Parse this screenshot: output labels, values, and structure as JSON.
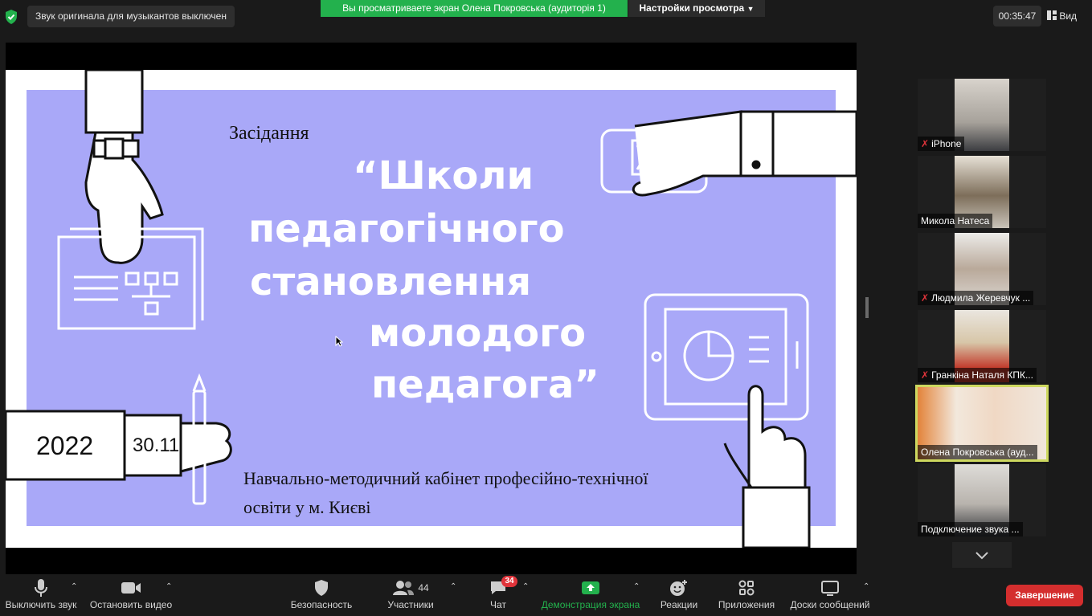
{
  "topbar": {
    "audio_notice": "Звук оригинала для музыкантов выключен",
    "share_banner": "Вы просматриваете экран Олена Покровська (аудиторія 1)",
    "view_settings": "Настройки просмотра",
    "timer": "00:35:47",
    "view_label": "Вид"
  },
  "slide": {
    "heading_small": "Засідання",
    "title_line1": "“Школи",
    "title_line2": "педагогічного",
    "title_line3": "становлення",
    "title_line4": "молодого",
    "title_line5": "педагога”",
    "year": "2022",
    "date": "30.11",
    "org_line1": "Навчально-методичний кабінет професійно-технічної",
    "org_line2": "освіти у м. Києві"
  },
  "participants": [
    {
      "name": "iPhone",
      "muted": true
    },
    {
      "name": "Микола Натеса",
      "muted": false
    },
    {
      "name": "Людмила Жеревчук ...",
      "muted": true
    },
    {
      "name": "Гранкіна Наталя КПК...",
      "muted": true
    },
    {
      "name": "Олена Покровська (ауд...",
      "muted": false
    },
    {
      "name": "Подключение звука ...",
      "muted": false
    }
  ],
  "toolbar": {
    "mute": "Выключить звук",
    "video": "Остановить видео",
    "security": "Безопасность",
    "participants": "Участники",
    "participants_count": "44",
    "chat": "Чат",
    "chat_badge": "34",
    "share": "Демонстрация экрана",
    "reactions": "Реакции",
    "apps": "Приложения",
    "boards": "Доски сообщений",
    "end": "Завершение"
  },
  "colors": {
    "share_green": "#23b14d",
    "slide_purple": "#a9a8f8",
    "end_red": "#d42e2e",
    "active_speaker": "#cdd85f"
  }
}
